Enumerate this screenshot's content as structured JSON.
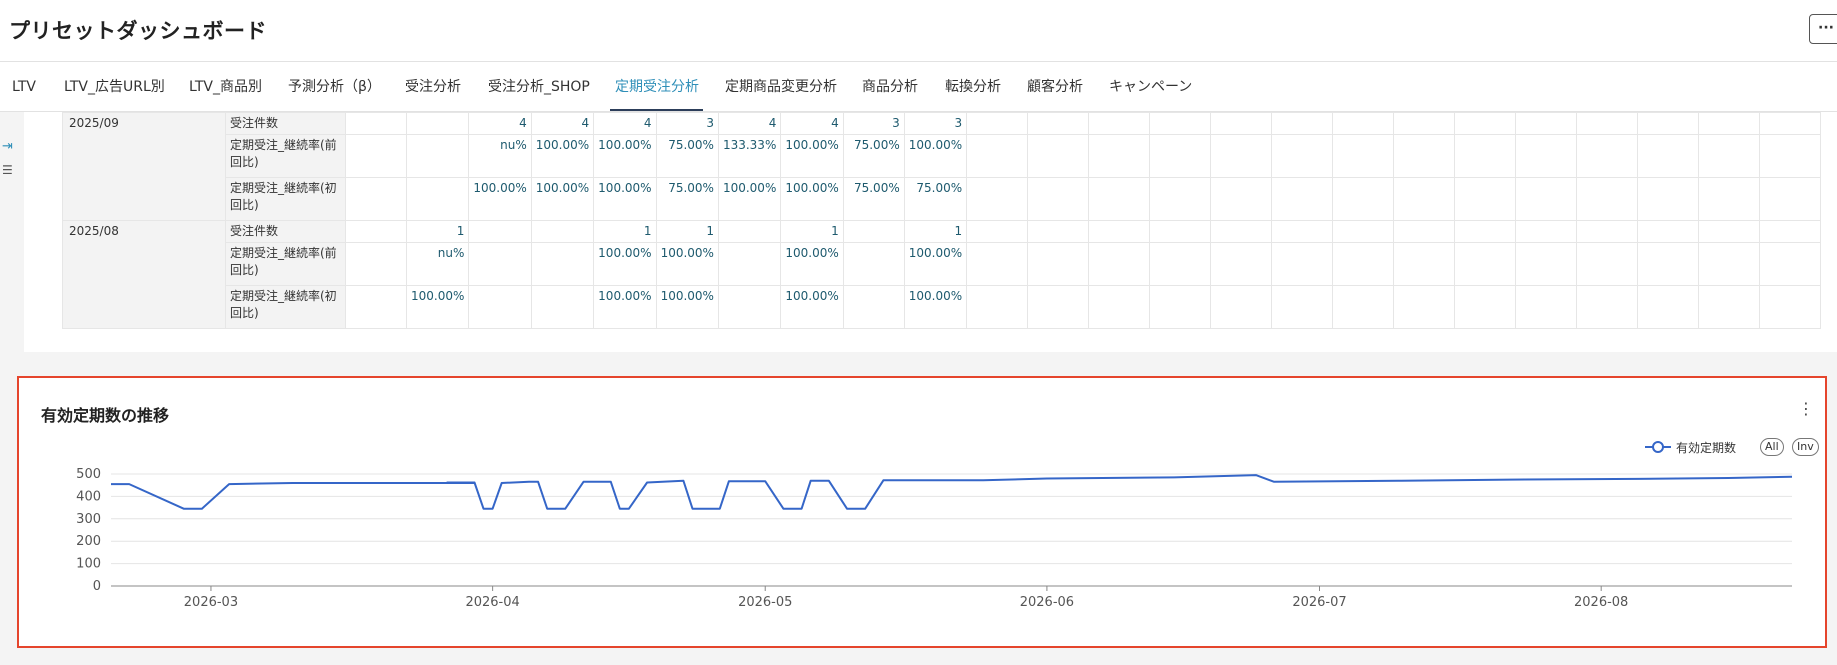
{
  "page": {
    "title": "プリセットダッシュボード",
    "more_button": "···"
  },
  "tabs": [
    {
      "label": "LTV",
      "active": false
    },
    {
      "label": "LTV_広告URL別",
      "active": false
    },
    {
      "label": "LTV_商品別",
      "active": false
    },
    {
      "label": "予測分析（β）",
      "active": false
    },
    {
      "label": "受注分析",
      "active": false
    },
    {
      "label": "受注分析_SHOP",
      "active": false
    },
    {
      "label": "定期受注分析",
      "active": true
    },
    {
      "label": "定期商品変更分析",
      "active": false
    },
    {
      "label": "商品分析",
      "active": false
    },
    {
      "label": "転換分析",
      "active": false
    },
    {
      "label": "顧客分析",
      "active": false
    },
    {
      "label": "キャンペーン",
      "active": false
    }
  ],
  "left_rail": {
    "expand_icon": "expand-right-icon",
    "filter_icon": "filter-icon",
    "expand_glyph": "⇥",
    "filter_glyph": "☰"
  },
  "table": {
    "groups": [
      {
        "month": "2025/09",
        "rows": [
          {
            "metric": "受注件数",
            "cells": [
              "",
              "",
              "4",
              "4",
              "4",
              "3",
              "4",
              "4",
              "3",
              "3"
            ]
          },
          {
            "metric": "定期受注_継続率(前回比)",
            "cells": [
              "",
              "",
              "nu%",
              "100.00%",
              "100.00%",
              "75.00%",
              "133.33%",
              "100.00%",
              "75.00%",
              "100.00%"
            ]
          },
          {
            "metric": "定期受注_継続率(初回比)",
            "cells": [
              "",
              "",
              "100.00%",
              "100.00%",
              "100.00%",
              "75.00%",
              "100.00%",
              "100.00%",
              "75.00%",
              "75.00%"
            ]
          }
        ]
      },
      {
        "month": "2025/08",
        "rows": [
          {
            "metric": "受注件数",
            "cells": [
              "",
              "1",
              "",
              "",
              "1",
              "1",
              "",
              "1",
              "",
              "1"
            ]
          },
          {
            "metric": "定期受注_継続率(前回比)",
            "cells": [
              "",
              "nu%",
              "",
              "",
              "100.00%",
              "100.00%",
              "",
              "100.00%",
              "",
              "100.00%"
            ]
          },
          {
            "metric": "定期受注_継続率(初回比)",
            "cells": [
              "",
              "100.00%",
              "",
              "",
              "100.00%",
              "100.00%",
              "",
              "100.00%",
              "",
              "100.00%"
            ]
          }
        ]
      }
    ],
    "empty_trailing_columns": 14
  },
  "chart_panel": {
    "title": "有効定期数の推移",
    "menu_icon": "kebab-menu-icon",
    "menu_glyph": "⋮",
    "legend_all": "All",
    "legend_inv": "Inv"
  },
  "chart_data": {
    "type": "line",
    "title": "有効定期数の推移",
    "xlabel": "",
    "ylabel": "",
    "x_range": [
      "2026-02-18",
      "2026-08-22"
    ],
    "ylim": [
      0,
      500
    ],
    "y_ticks": [
      0,
      100,
      200,
      300,
      400,
      500
    ],
    "x_ticks": [
      "2026-03",
      "2026-04",
      "2026-05",
      "2026-06",
      "2026-07",
      "2026-08"
    ],
    "grid": true,
    "legend_position": "top-right",
    "series": [
      {
        "name": "有効定期数",
        "color": "#3566c8",
        "points": [
          [
            "2026-02-18",
            455
          ],
          [
            "2026-02-20",
            455
          ],
          [
            "2026-02-26",
            345
          ],
          [
            "2026-02-28",
            345
          ],
          [
            "2026-03-03",
            455
          ],
          [
            "2026-03-10",
            460
          ],
          [
            "2026-03-20",
            460
          ],
          [
            "2026-03-30",
            460
          ],
          [
            "2026-03-27",
            462
          ],
          [
            "2026-03-30",
            462
          ],
          [
            "2026-03-31",
            345
          ],
          [
            "2026-03-31",
            345
          ],
          [
            "2026-04-01",
            345
          ],
          [
            "2026-04-02",
            460
          ],
          [
            "2026-04-05",
            465
          ],
          [
            "2026-04-06",
            465
          ],
          [
            "2026-04-07",
            345
          ],
          [
            "2026-04-09",
            345
          ],
          [
            "2026-04-11",
            465
          ],
          [
            "2026-04-14",
            465
          ],
          [
            "2026-04-15",
            345
          ],
          [
            "2026-04-16",
            345
          ],
          [
            "2026-04-18",
            462
          ],
          [
            "2026-04-22",
            470
          ],
          [
            "2026-04-23",
            345
          ],
          [
            "2026-04-26",
            345
          ],
          [
            "2026-04-27",
            468
          ],
          [
            "2026-05-01",
            468
          ],
          [
            "2026-05-03",
            345
          ],
          [
            "2026-05-05",
            345
          ],
          [
            "2026-05-06",
            470
          ],
          [
            "2026-05-08",
            470
          ],
          [
            "2026-05-10",
            345
          ],
          [
            "2026-05-12",
            345
          ],
          [
            "2026-05-14",
            472
          ],
          [
            "2026-05-25",
            472
          ],
          [
            "2026-06-01",
            480
          ],
          [
            "2026-06-15",
            485
          ],
          [
            "2026-06-24",
            495
          ],
          [
            "2026-06-26",
            465
          ],
          [
            "2026-07-10",
            470
          ],
          [
            "2026-07-22",
            475
          ],
          [
            "2026-08-05",
            478
          ],
          [
            "2026-08-15",
            482
          ],
          [
            "2026-08-22",
            488
          ]
        ]
      }
    ]
  }
}
